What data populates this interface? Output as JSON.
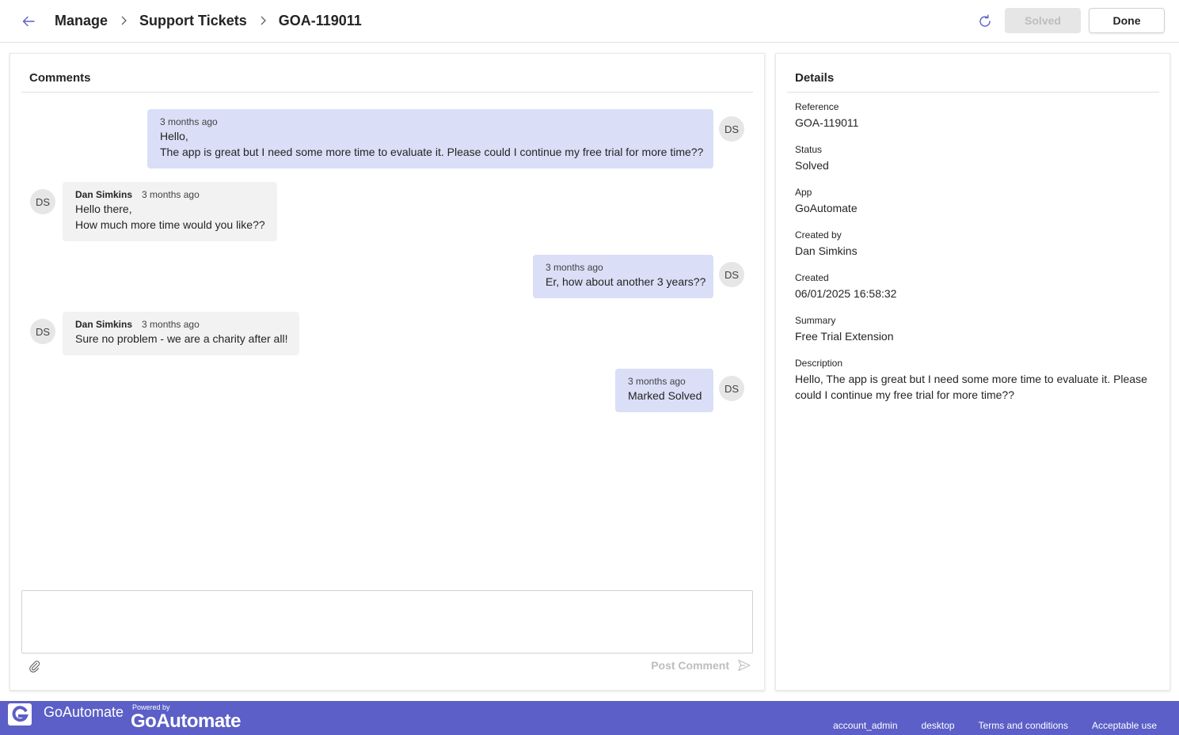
{
  "breadcrumb": [
    "Manage",
    "Support Tickets",
    "GOA-119011"
  ],
  "toolbar": {
    "solved_label": "Solved",
    "done_label": "Done"
  },
  "comments": {
    "title": "Comments",
    "messages": [
      {
        "side": "mine",
        "author": "",
        "time": "3 months ago",
        "lines": [
          "Hello,",
          "The app is great but I need some more time to evaluate it. Please could I continue my free trial for more time??"
        ],
        "avatar": "DS"
      },
      {
        "side": "theirs",
        "author": "Dan Simkins",
        "time": "3 months ago",
        "lines": [
          "Hello there,",
          "How much more time would you like??"
        ],
        "avatar": "DS"
      },
      {
        "side": "mine",
        "author": "",
        "time": "3 months ago",
        "lines": [
          "Er, how about another 3 years??"
        ],
        "avatar": "DS"
      },
      {
        "side": "theirs",
        "author": "Dan Simkins",
        "time": "3 months ago",
        "lines": [
          "Sure no problem - we are a charity after all!"
        ],
        "avatar": "DS"
      },
      {
        "side": "mine",
        "author": "",
        "time": "3 months ago",
        "lines": [
          "Marked Solved"
        ],
        "avatar": "DS"
      }
    ],
    "input_value": "",
    "post_label": "Post Comment"
  },
  "details": {
    "title": "Details",
    "fields": [
      {
        "label": "Reference",
        "value": "GOA-119011"
      },
      {
        "label": "Status",
        "value": "Solved"
      },
      {
        "label": "App",
        "value": "GoAutomate"
      },
      {
        "label": "Created by",
        "value": "Dan Simkins"
      },
      {
        "label": "Created",
        "value": "06/01/2025 16:58:32"
      },
      {
        "label": "Summary",
        "value": "Free Trial Extension"
      },
      {
        "label": "Description",
        "value": "Hello, The app is great but I need some more time to evaluate it. Please could I continue my free trial for more time??"
      }
    ]
  },
  "footer": {
    "app_name": "GoAutomate",
    "powered_by": "Powered by",
    "brand": "GoAutomate",
    "links": [
      "account_admin",
      "desktop",
      "Terms and conditions",
      "Acceptable use"
    ]
  },
  "colors": {
    "accent": "#5b5fc7",
    "my_bubble": "#dadff7",
    "their_bubble": "#f2f2f2"
  },
  "icons": {
    "back": "arrow-left-icon",
    "refresh": "refresh-icon",
    "attach": "paperclip-icon",
    "send": "send-icon",
    "chevron": "chevron-right-icon"
  }
}
